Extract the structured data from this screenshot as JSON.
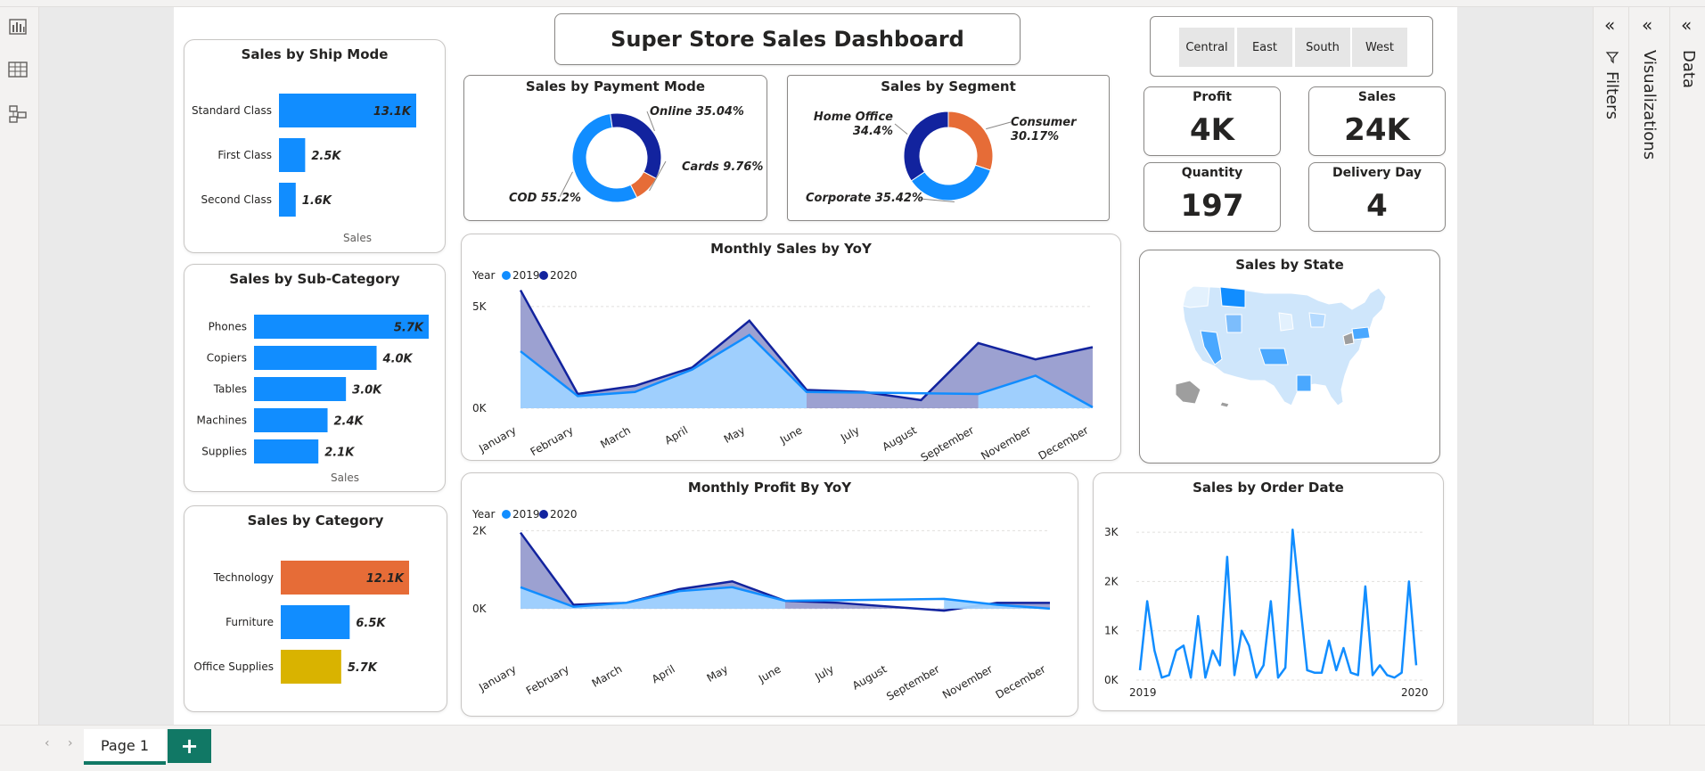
{
  "dashboard": {
    "title": "Super Store Sales Dashboard",
    "regions": [
      "Central",
      "East",
      "South",
      "West"
    ]
  },
  "kpis": [
    {
      "label": "Profit",
      "value": "4K"
    },
    {
      "label": "Sales",
      "value": "24K"
    },
    {
      "label": "Quantity",
      "value": "197"
    },
    {
      "label": "Delivery Day",
      "value": "4"
    }
  ],
  "colors": {
    "blue": "#118dff",
    "dark_navy": "#12239e",
    "orange": "#e66c37",
    "gold": "#d9b300",
    "light_blue_fill": "#9fd2ff",
    "navy_fill": "#8b90c9"
  },
  "ship_mode": {
    "title": "Sales by Ship Mode",
    "axis_label": "Sales",
    "chart_data": {
      "type": "bar",
      "categories": [
        "Standard Class",
        "First Class",
        "Second Class"
      ],
      "values": [
        13.1,
        2.5,
        1.6
      ],
      "labels": [
        "13.1K",
        "2.5K",
        "1.6K"
      ]
    }
  },
  "sub_category": {
    "title": "Sales by Sub-Category",
    "axis_label": "Sales",
    "chart_data": {
      "type": "bar",
      "categories": [
        "Phones",
        "Copiers",
        "Tables",
        "Machines",
        "Supplies"
      ],
      "values": [
        5.7,
        4.0,
        3.0,
        2.4,
        2.1
      ],
      "labels": [
        "5.7K",
        "4.0K",
        "3.0K",
        "2.4K",
        "2.1K"
      ]
    }
  },
  "category": {
    "title": "Sales by Category",
    "chart_data": {
      "type": "bar",
      "categories": [
        "Technology",
        "Furniture",
        "Office Supplies"
      ],
      "values": [
        12.1,
        6.5,
        5.7
      ],
      "labels": [
        "12.1K",
        "6.5K",
        "5.7K"
      ],
      "colors": [
        "#e66c37",
        "#118dff",
        "#d9b300"
      ]
    }
  },
  "payment_mode": {
    "title": "Sales by Payment Mode",
    "chart_data": {
      "type": "pie",
      "categories": [
        "COD",
        "Online",
        "Cards"
      ],
      "values": [
        55.2,
        35.04,
        9.76
      ],
      "labels": [
        "COD 55.2%",
        "Online 35.04%",
        "Cards 9.76%"
      ],
      "colors": [
        "#118dff",
        "#12239e",
        "#e66c37"
      ]
    }
  },
  "segment": {
    "title": "Sales by Segment",
    "chart_data": {
      "type": "pie",
      "categories": [
        "Consumer",
        "Corporate",
        "Home Office"
      ],
      "values": [
        30.17,
        35.42,
        34.4
      ],
      "labels": [
        "Consumer 30.17%",
        "Corporate 35.42%",
        "Home Office 34.4%"
      ],
      "label_lines": [
        [
          "Consumer",
          "30.17%"
        ],
        [
          "Corporate 35.42%"
        ],
        [
          "Home Office",
          "34.4%"
        ]
      ],
      "colors": [
        "#e66c37",
        "#118dff",
        "#12239e"
      ]
    }
  },
  "monthly_sales": {
    "title": "Monthly Sales by YoY",
    "legend_title": "Year",
    "chart_data": {
      "type": "area",
      "categories": [
        "January",
        "February",
        "March",
        "April",
        "May",
        "June",
        "July",
        "August",
        "September",
        "November",
        "December"
      ],
      "y_ticks": [
        "0K",
        "5K"
      ],
      "ylim": [
        0,
        6
      ],
      "series": [
        {
          "name": "2019",
          "values": [
            2.8,
            0.6,
            0.8,
            1.9,
            3.6,
            0.8,
            null,
            null,
            0.7,
            1.6,
            0.05
          ]
        },
        {
          "name": "2020",
          "values": [
            5.8,
            0.7,
            1.1,
            2.0,
            4.3,
            0.9,
            0.8,
            0.4,
            3.2,
            2.4,
            3.0
          ]
        }
      ]
    }
  },
  "monthly_profit": {
    "title": "Monthly Profit By YoY",
    "legend_title": "Year",
    "chart_data": {
      "type": "area",
      "categories": [
        "January",
        "February",
        "March",
        "April",
        "May",
        "June",
        "July",
        "August",
        "September",
        "November",
        "December"
      ],
      "y_ticks": [
        "0K",
        "2K"
      ],
      "ylim": [
        -0.3,
        2.1
      ],
      "series": [
        {
          "name": "2019",
          "values": [
            0.55,
            0.05,
            0.15,
            0.45,
            0.55,
            0.2,
            null,
            null,
            0.25,
            0.1,
            0.0
          ]
        },
        {
          "name": "2020",
          "values": [
            1.95,
            0.1,
            0.15,
            0.5,
            0.7,
            0.2,
            0.15,
            0.05,
            -0.05,
            0.15,
            0.15
          ]
        }
      ]
    }
  },
  "order_date": {
    "title": "Sales by Order Date",
    "chart_data": {
      "type": "line",
      "x_labels": [
        "2019",
        "2020"
      ],
      "y_ticks": [
        "0K",
        "1K",
        "2K",
        "3K"
      ],
      "ylim": [
        0,
        3.2
      ],
      "values": [
        0.2,
        1.6,
        0.6,
        0.05,
        0.1,
        0.6,
        0.7,
        0.05,
        1.3,
        0.05,
        0.6,
        0.3,
        2.5,
        0.1,
        1.0,
        0.7,
        0.05,
        0.3,
        1.6,
        0.05,
        0.25,
        3.05,
        1.6,
        0.2,
        0.15,
        0.15,
        0.8,
        0.2,
        0.65,
        0.15,
        0.1,
        1.9,
        0.1,
        0.3,
        0.1,
        0.05,
        0.15,
        2.0,
        0.3
      ]
    }
  },
  "state_map": {
    "title": "Sales by State"
  },
  "panes": {
    "filters": "Filters",
    "visualizations": "Visualizations",
    "data": "Data"
  },
  "pages": {
    "active": "Page 1",
    "add": "+"
  },
  "icons": [
    "report-view-icon",
    "table-view-icon",
    "model-view-icon",
    "filter-icon",
    "collapse-icon",
    "nav-prev-icon",
    "nav-next-icon"
  ]
}
